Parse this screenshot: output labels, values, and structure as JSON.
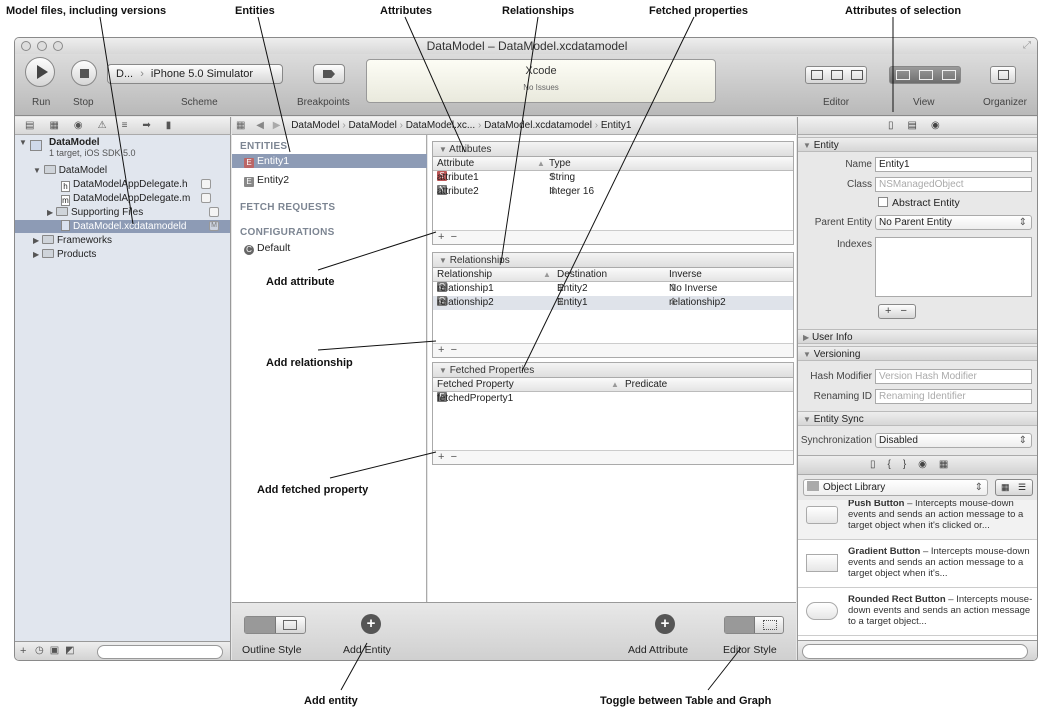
{
  "annotations": {
    "model_files": "Model files, including versions",
    "entities": "Entities",
    "attributes": "Attributes",
    "relationships": "Relationships",
    "fetched_properties": "Fetched properties",
    "attributes_of_selection": "Attributes of selection",
    "add_attribute": "Add attribute",
    "add_relationship": "Add relationship",
    "add_fetched_property": "Add fetched property",
    "add_entity": "Add entity",
    "toggle_table_graph": "Toggle between Table and Graph"
  },
  "window": {
    "title": "DataModel – DataModel.xcdatamodel"
  },
  "toolbar": {
    "run_label": "Run",
    "stop_label": "Stop",
    "scheme_target": "D...",
    "scheme_destination": "iPhone 5.0 Simulator",
    "scheme_label": "Scheme",
    "breakpoints_label": "Breakpoints",
    "activity_title": "Xcode",
    "activity_status": "No Issues",
    "editor_label": "Editor",
    "view_label": "View",
    "organizer_label": "Organizer"
  },
  "navigator": {
    "project_name": "DataModel",
    "project_sub": "1 target, iOS SDK 5.0",
    "group": "DataModel",
    "files": [
      {
        "name": "DataModelAppDelegate.h",
        "icon": "h"
      },
      {
        "name": "DataModelAppDelegate.m",
        "icon": "m"
      }
    ],
    "supporting": "Supporting Files",
    "model_file": "DataModel.xcdatamodeld",
    "model_badge": "M",
    "frameworks": "Frameworks",
    "products": "Products"
  },
  "jumpbar": [
    "DataModel",
    "DataModel",
    "DataModel.xc...",
    "DataModel.xcdatamodel",
    "Entity1"
  ],
  "entities_panel": {
    "entities_header": "ENTITIES",
    "entities": [
      "Entity1",
      "Entity2"
    ],
    "fetch_header": "FETCH REQUESTS",
    "config_header": "CONFIGURATIONS",
    "config_default": "Default"
  },
  "attributes_section": {
    "title": "Attributes",
    "col_attribute": "Attribute",
    "col_type": "Type",
    "rows": [
      {
        "badge": "S",
        "name": "attribute1",
        "type": "String"
      },
      {
        "badge": "N",
        "name": "attribute2",
        "type": "Integer 16"
      }
    ]
  },
  "relationships_section": {
    "title": "Relationships",
    "col_relationship": "Relationship",
    "col_destination": "Destination",
    "col_inverse": "Inverse",
    "rows": [
      {
        "badge": "O",
        "name": "relationship1",
        "destination": "Entity2",
        "inverse": "No Inverse"
      },
      {
        "badge": "O",
        "name": "relationship2",
        "destination": "Entity1",
        "inverse": "relationship2"
      }
    ]
  },
  "fetched_section": {
    "title": "Fetched Properties",
    "col_property": "Fetched Property",
    "col_predicate": "Predicate",
    "rows": [
      {
        "badge": "F",
        "name": "fetchedProperty1"
      }
    ]
  },
  "bottom_bar": {
    "outline_style": "Outline Style",
    "add_entity": "Add Entity",
    "add_attribute": "Add Attribute",
    "editor_style": "Editor Style"
  },
  "inspector": {
    "entity_header": "Entity",
    "name_label": "Name",
    "name_value": "Entity1",
    "class_label": "Class",
    "class_placeholder": "NSManagedObject",
    "abstract_label": "Abstract Entity",
    "parent_label": "Parent Entity",
    "parent_value": "No Parent Entity",
    "indexes_label": "Indexes",
    "user_info": "User Info",
    "versioning": "Versioning",
    "hash_label": "Hash Modifier",
    "hash_placeholder": "Version Hash Modifier",
    "renaming_label": "Renaming ID",
    "renaming_placeholder": "Renaming Identifier",
    "entity_sync": "Entity Sync",
    "sync_label": "Synchronization",
    "sync_value": "Disabled"
  },
  "library": {
    "selector": "Object Library",
    "items": [
      {
        "title": "Push Button",
        "desc": " – Intercepts mouse-down events and sends an action message to a target object when it's clicked or..."
      },
      {
        "title": "Gradient Button",
        "desc": " – Intercepts mouse-down events and sends an action message to a target object when it's..."
      },
      {
        "title": "Rounded Rect Button",
        "desc": " – Intercepts mouse-down events and sends an action message to a target object..."
      }
    ]
  }
}
